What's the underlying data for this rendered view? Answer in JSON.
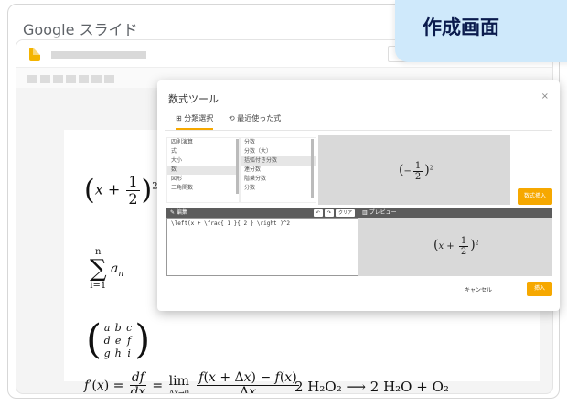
{
  "frame": {
    "title": "Google スライド"
  },
  "banner": {
    "text": "作成画面"
  },
  "dialog": {
    "title": "数式ツール",
    "close": "×",
    "tabs": [
      {
        "label": "⊞ 分類選択"
      },
      {
        "label": "⟲ 最近使った式"
      }
    ],
    "category_list": [
      "四則演算",
      "式",
      "大小",
      "数",
      "図形",
      "三角関数"
    ],
    "subcategory_list": [
      "分数",
      "分数（大）",
      "括弧付き分数",
      "連分数",
      "階乗分数",
      "分数"
    ],
    "insert_button": "数式挿入",
    "edit_header": "✎ 編集",
    "edit_buttons": [
      "↶",
      "↷",
      "クリア"
    ],
    "preview_header": "▥ プレビュー",
    "edit_content": "\\left(x + \\frac{ 1 }{ 2 } \\right )^2",
    "cancel_button": "キャンセル",
    "ok_button": "挿入"
  },
  "slide_math": {
    "sub_i": "i=1",
    "sup_n": "n",
    "reaction": "2 H₂O₂ ⟶ 2 H₂O + O₂"
  },
  "colors": {
    "accent": "#f6a800",
    "banner": "#cfe9fb",
    "banner_text": "#0b1b4d"
  }
}
